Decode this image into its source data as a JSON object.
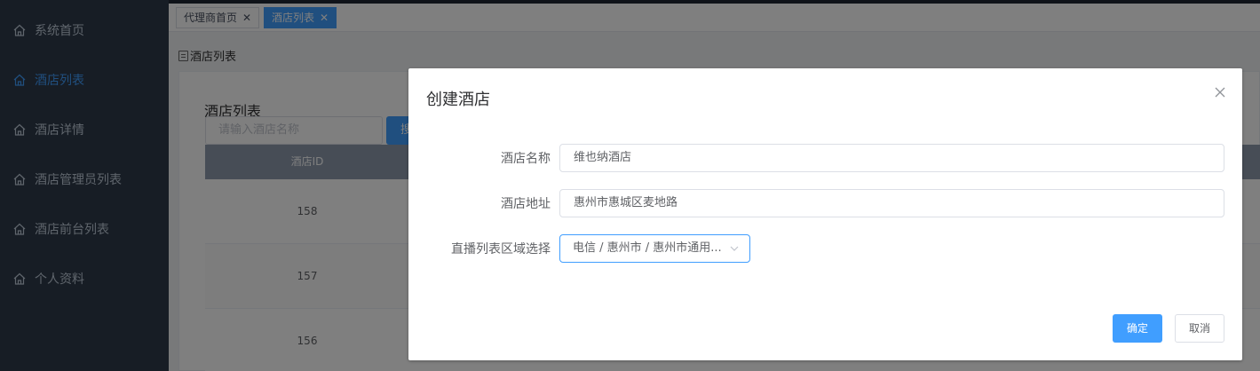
{
  "sidebar": {
    "items": [
      {
        "label": "系统首页",
        "icon": "home-icon",
        "active": false
      },
      {
        "label": "酒店列表",
        "icon": "home-icon",
        "active": true
      },
      {
        "label": "酒店详情",
        "icon": "home-icon",
        "active": false
      },
      {
        "label": "酒店管理员列表",
        "icon": "home-icon",
        "active": false
      },
      {
        "label": "酒店前台列表",
        "icon": "home-icon",
        "active": false
      },
      {
        "label": "个人资料",
        "icon": "home-icon",
        "active": false
      }
    ]
  },
  "tabs": [
    {
      "label": "代理商首页",
      "active": false
    },
    {
      "label": "酒店列表",
      "active": true
    }
  ],
  "breadcrumb": {
    "label": "酒店列表"
  },
  "panel": {
    "title": "酒店列表",
    "search_placeholder": "请输入酒店名称",
    "search_button": "搜索"
  },
  "table": {
    "columns": [
      "酒店ID"
    ],
    "rows": [
      [
        "158"
      ],
      [
        "157"
      ],
      [
        "156"
      ]
    ]
  },
  "dialog": {
    "title": "创建酒店",
    "fields": {
      "name_label": "酒店名称",
      "name_value": "维也纳酒店",
      "address_label": "酒店地址",
      "address_value": "惠州市惠城区麦地路",
      "region_label": "直播列表区域选择",
      "region_value": "电信 / 惠州市 / 惠州市通用..."
    },
    "confirm_button": "确定",
    "cancel_button": "取消"
  },
  "colors": {
    "sidebar_bg": "#2e3a4a",
    "accent": "#409eff",
    "table_header": "#8e9bad"
  }
}
